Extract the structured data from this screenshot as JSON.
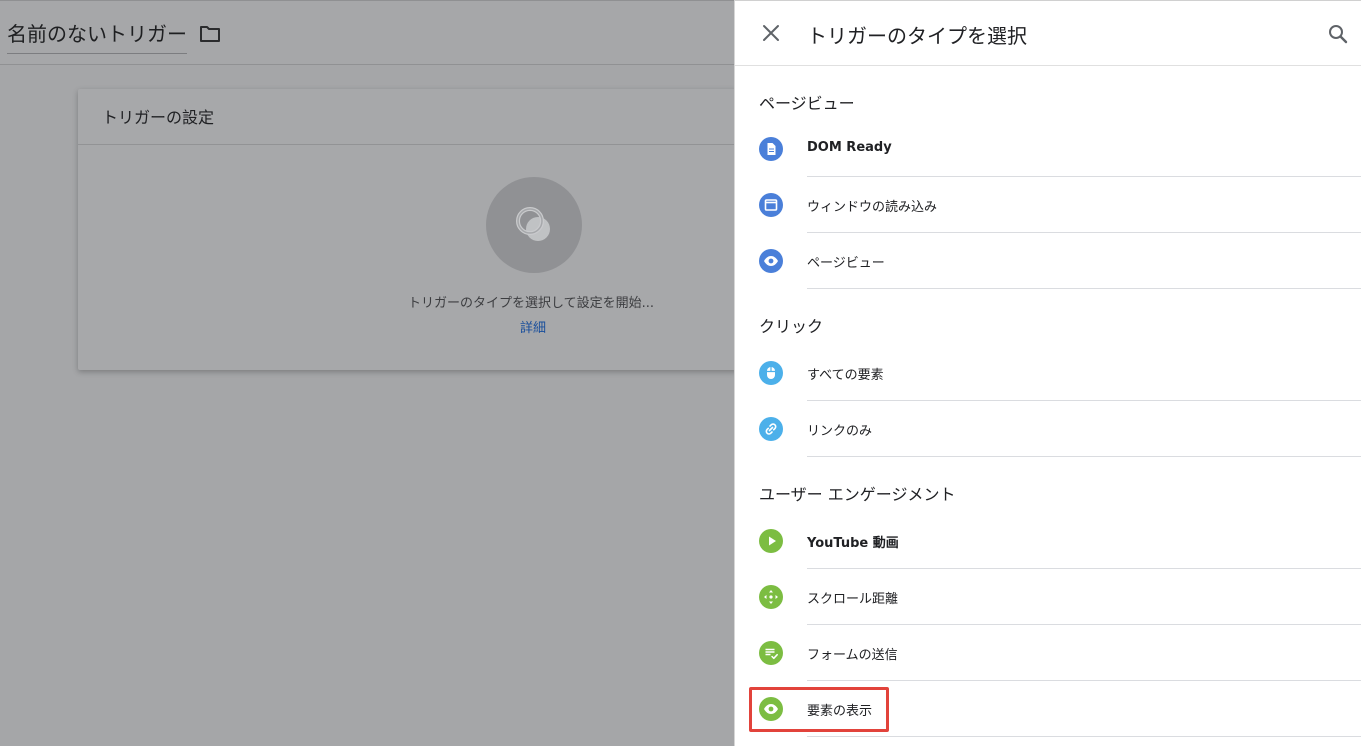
{
  "background": {
    "trigger_name": "名前のないトリガー",
    "card_title": "トリガーの設定",
    "hint_text": "トリガーのタイプを選択して設定を開始...",
    "details_link": "詳細"
  },
  "panel": {
    "title": "トリガーのタイプを選択",
    "sections": {
      "pageview": {
        "title": "ページビュー",
        "items": [
          "DOM Ready",
          "ウィンドウの読み込み",
          "ページビュー"
        ]
      },
      "click": {
        "title": "クリック",
        "items": [
          "すべての要素",
          "リンクのみ"
        ]
      },
      "engagement": {
        "title": "ユーザー エンゲージメント",
        "items": [
          "YouTube 動画",
          "スクロール距離",
          "フォームの送信",
          "要素の表示"
        ]
      }
    }
  },
  "colors": {
    "pageview_icon": "#4a7fd9",
    "click_icon": "#4cb0ea",
    "engagement_icon": "#7cbd42",
    "highlight": "#e2433b"
  }
}
